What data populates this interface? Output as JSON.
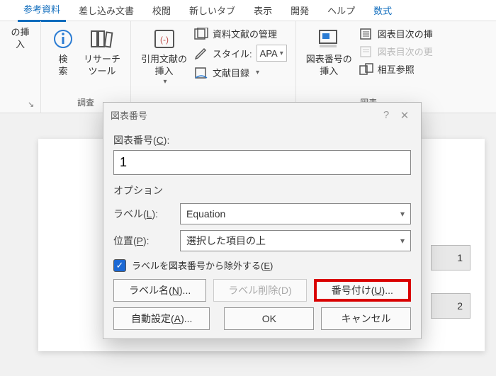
{
  "tabs": {
    "references": "参考資料",
    "mailings": "差し込み文書",
    "review": "校閲",
    "newtab": "新しいタブ",
    "view": "表示",
    "developer": "開発",
    "help": "ヘルプ",
    "equation": "数式"
  },
  "ribbon": {
    "insert_note_partial": "の挿入",
    "search": "検\n索",
    "research_tool": "リサーチ\nツール",
    "research_group": "調査",
    "citation": "引用文献の\n挿入",
    "manage_sources": "資料文献の管理",
    "style_label": "スタイル:",
    "style_value": "APA",
    "bibliography": "文献目録",
    "caption": "図表番号の\n挿入",
    "tof": "図表目次の挿",
    "tof_update": "図表目次の更",
    "crossref": "相互参照",
    "caption_group": "図表"
  },
  "doc": {
    "num1": "1",
    "num2": "2"
  },
  "dialog": {
    "title": "図表番号",
    "caption_label_pre": "図表番号(",
    "caption_label_key": "C",
    "caption_label_post": "):",
    "caption_value": "1",
    "options": "オプション",
    "label_lab_pre": "ラベル(",
    "label_lab_key": "L",
    "label_lab_post": "):",
    "label_value": "Equation",
    "pos_lab_pre": "位置(",
    "pos_lab_key": "P",
    "pos_lab_post": "):",
    "pos_value": "選択した項目の上",
    "exclude_pre": "ラベルを図表番号から除外する(",
    "exclude_key": "E",
    "exclude_post": ")",
    "newlabel_pre": "ラベル名(",
    "newlabel_key": "N",
    "newlabel_post": ")...",
    "dellabel": "ラベル削除(D)",
    "numbering_pre": "番号付け(",
    "numbering_key": "U",
    "numbering_post": ")...",
    "autocaption_pre": "自動設定(",
    "autocaption_key": "A",
    "autocaption_post": ")...",
    "ok": "OK",
    "cancel": "キャンセル"
  }
}
